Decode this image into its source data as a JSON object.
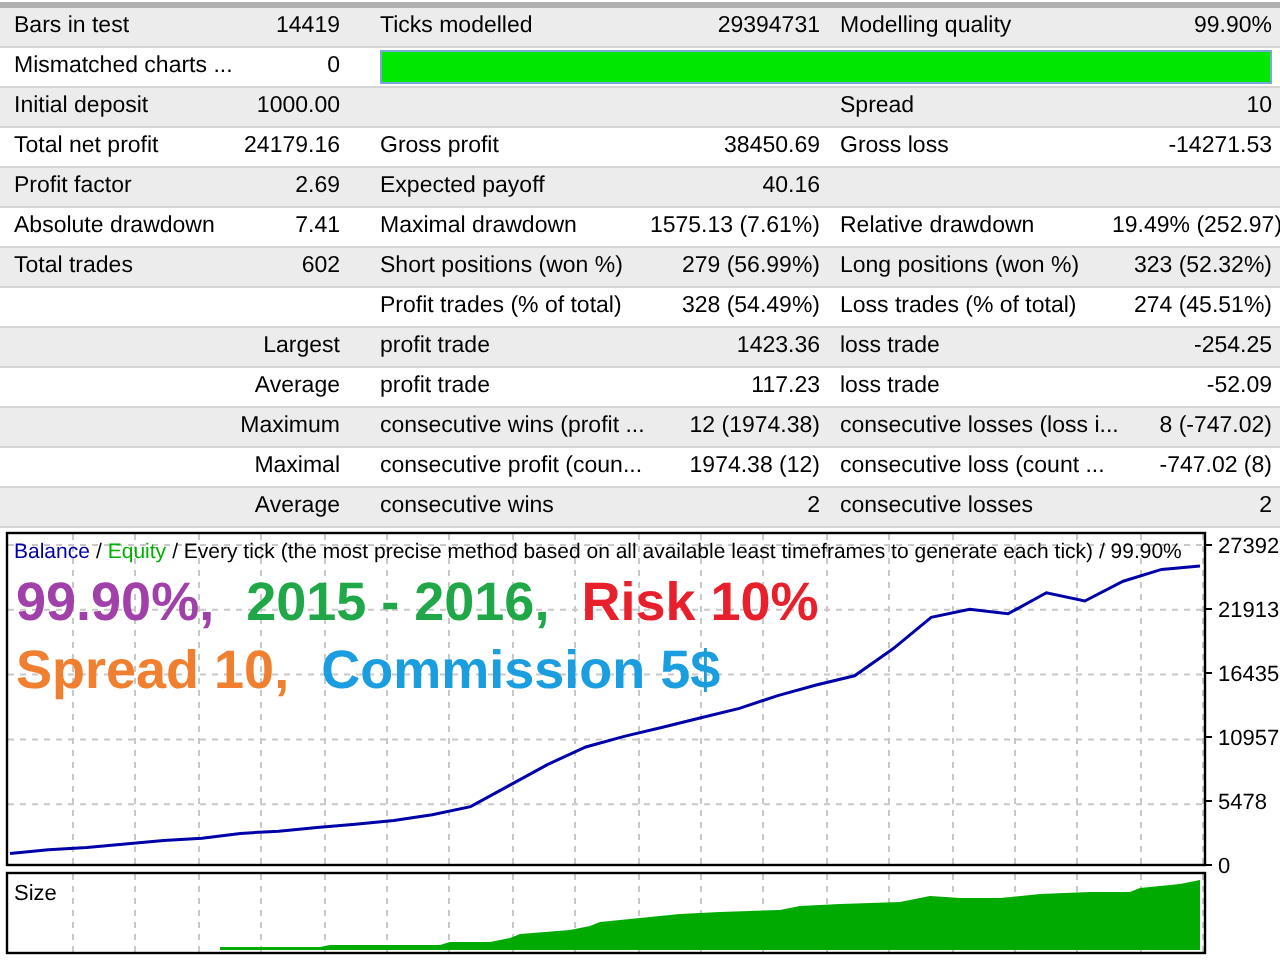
{
  "report_rows": [
    {
      "kind": "full",
      "col_1": "Bars in test",
      "col_2": "14419",
      "col_3": "Ticks modelled",
      "col_4": "29394731",
      "col_5": "Modelling quality",
      "col_6": "99.90%"
    },
    {
      "kind": "bar",
      "col_1": "Mismatched charts ...",
      "col_2": "0",
      "level": 1
    },
    {
      "kind": "full",
      "col_1": "Initial deposit",
      "col_2": "1000.00",
      "col_5": "Spread",
      "col_6": "10"
    },
    {
      "kind": "full",
      "col_1": "Total net profit",
      "col_2": "24179.16",
      "col_3": "Gross profit",
      "col_4": "38450.69",
      "col_5": "Gross loss",
      "col_6": "-14271.53"
    },
    {
      "kind": "full",
      "col_1": "Profit factor",
      "col_2": "2.69",
      "col_3": "Expected payoff",
      "col_4": "40.16"
    },
    {
      "kind": "full",
      "col_1": "Absolute drawdown",
      "col_2": "7.41",
      "col_3": "Maximal drawdown",
      "col_4": "1575.13 (7.61%)",
      "col_5": "Relative drawdown",
      "col_6": "19.49% (252.97)"
    },
    {
      "kind": "full",
      "col_1": "Total trades",
      "col_2": "602",
      "col_3": "Short positions (won %)",
      "col_4": "279 (56.99%)",
      "col_5": "Long positions (won %)",
      "col_6": "323 (52.32%)"
    },
    {
      "kind": "full",
      "col_3": "Profit trades (% of total)",
      "col_4": "328 (54.49%)",
      "col_5": "Loss trades (% of total)",
      "col_6": "274 (45.51%)"
    },
    {
      "kind": "full",
      "col_2": "Largest",
      "col_3": "profit trade",
      "col_4": "1423.36",
      "col_5": "loss trade",
      "col_6": "-254.25"
    },
    {
      "kind": "full",
      "col_2": "Average",
      "col_3": "profit trade",
      "col_4": "117.23",
      "col_5": "loss trade",
      "col_6": "-52.09"
    },
    {
      "kind": "full",
      "col_2": "Maximum",
      "col_3": "consecutive wins (profit ...",
      "col_4": "12 (1974.38)",
      "col_5": "consecutive losses (loss i...",
      "col_6": "8 (-747.02)"
    },
    {
      "kind": "full",
      "col_2": "Maximal",
      "col_3": "consecutive profit (coun...",
      "col_4": "1974.38 (12)",
      "col_5": "consecutive loss (count ...",
      "col_6": "-747.02 (8)"
    },
    {
      "kind": "full",
      "col_2": "Average",
      "col_3": "consecutive wins",
      "col_4": "2",
      "col_5": "consecutive losses",
      "col_6": "2"
    }
  ],
  "chart": {
    "legend": [
      {
        "kind": "sep",
        "text": "/"
      },
      {
        "kind": "equity",
        "text": "Equity"
      },
      {
        "kind": "plain",
        "text": "/ Every tick (the most precise method based on all available least timeframes to generate each tick) / 99.90%"
      }
    ],
    "overlay_lines": [
      [
        {
          "text": "99.90%,",
          "color": "#a040a8"
        },
        {
          "text": "2015 - 2016,",
          "color": "#20a848"
        },
        {
          "text": "Risk 10%",
          "color": "#e8202c"
        }
      ],
      [
        {
          "text": "Spread 10,",
          "color": "#f08030"
        },
        {
          "text": "Commission 5$",
          "color": "#1a9ee0"
        }
      ]
    ],
    "chart_data": {
      "type": "line",
      "grid": true,
      "ylim": [
        0,
        27392
      ],
      "yticks": [
        0,
        5478,
        10957,
        16435,
        21913,
        27392
      ],
      "series": [
        {
          "name": "Balance",
          "color": "#0000a8",
          "values": [
            1000,
            1300,
            1500,
            1800,
            2100,
            2300,
            2700,
            2900,
            3200,
            3500,
            3800,
            4300,
            5000,
            6800,
            8600,
            10100,
            11000,
            11800,
            12600,
            13400,
            14500,
            15400,
            16200,
            18500,
            21200,
            21900,
            21500,
            23300,
            22600,
            24300,
            25300,
            25600
          ]
        }
      ]
    },
    "size_panel_label": "Size"
  }
}
